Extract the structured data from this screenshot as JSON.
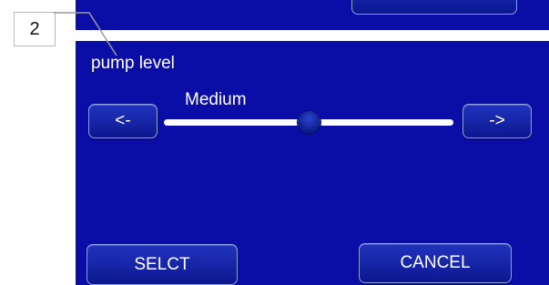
{
  "callout": {
    "number": "2"
  },
  "pump": {
    "title": "pump level",
    "value_label": "Medium",
    "level_fraction": 0.5
  },
  "buttons": {
    "prev": "<-",
    "next": "->",
    "select": "SELCT",
    "cancel": "CANCEL"
  },
  "colors": {
    "panel": "#0b0ea6",
    "text": "#ffffff",
    "track": "#ffffff"
  }
}
